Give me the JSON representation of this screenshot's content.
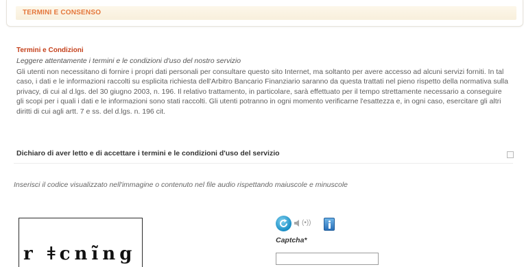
{
  "section": {
    "title": "TERMINI E CONSENSO"
  },
  "terms": {
    "title": "Termini e Condizioni",
    "subtitle": "Leggere attentamente i termini e le condizioni d'uso del nostro servizio",
    "body": "Gli utenti non necessitano di fornire i propri dati personali per consultare questo sito Internet, ma soltanto per avere accesso ad alcuni servizi forniti. In tal caso, i dati e le informazioni raccolti su esplicita richiesta dell'Arbitro Bancario Finanziario saranno da questa trattati nel pieno rispetto della normativa sulla privacy, di cui al d.lgs. del 30 giugno 2003, n. 196. Il relativo trattamento, in particolare, sarà effettuato per il tempo strettamente necessario a conseguire gli scopi per i quali i dati e le informazioni sono stati raccolti. Gli utenti potranno in ogni momento verificarne l'esattezza e, in ogni caso, esercitare gli altri diritti di cui agli artt. 7 e ss. del d.lgs. n. 196 cit.",
    "declare_label": "Dichiaro di aver letto e di accettare i termini e le condizioni d'uso del servizio"
  },
  "captcha": {
    "instructions": "Inserisci il codice visualizzato nell'immagine o contenuto nel file audio rispettando maiuscole e minuscole",
    "image_text": "r ǂcnĩng",
    "audio_label": "(•))",
    "field_label": "Captcha*",
    "input_value": ""
  }
}
